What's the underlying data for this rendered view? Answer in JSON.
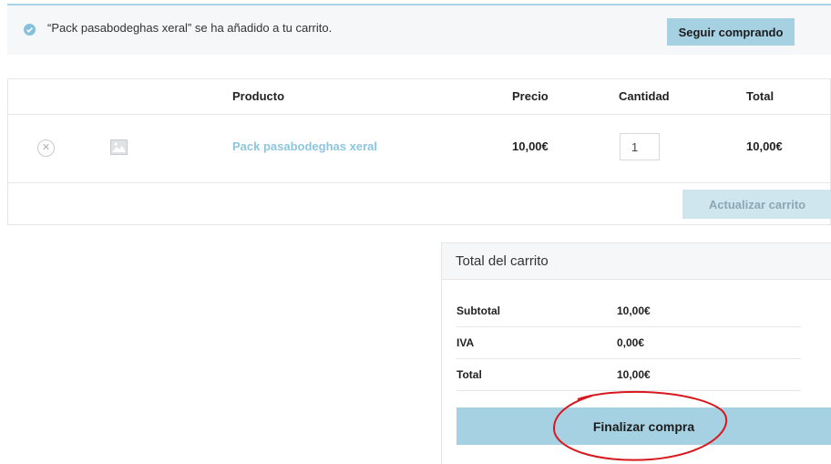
{
  "notice": {
    "message": "“Pack pasabodeghas xeral” se ha añadido a tu carrito.",
    "continue_button": "Seguir comprando"
  },
  "cart_table": {
    "headers": {
      "product": "Producto",
      "price": "Precio",
      "quantity": "Cantidad",
      "total": "Total"
    },
    "row": {
      "product_name": "Pack pasabodeghas xeral",
      "price": "10,00€",
      "quantity": "1",
      "total": "10,00€"
    },
    "update_button": "Actualizar carrito"
  },
  "cart_totals": {
    "title": "Total del carrito",
    "rows": [
      {
        "label": "Subtotal",
        "value": "10,00€"
      },
      {
        "label": "IVA",
        "value": "0,00€"
      },
      {
        "label": "Total",
        "value": "10,00€"
      }
    ],
    "checkout_button": "Finalizar compra"
  },
  "colors": {
    "accent": "#a5d1e3",
    "link": "#8cc6dd",
    "annotation": "#d7191f"
  },
  "icons": [
    "check-circle-icon",
    "remove-item-icon",
    "image-placeholder-icon"
  ]
}
